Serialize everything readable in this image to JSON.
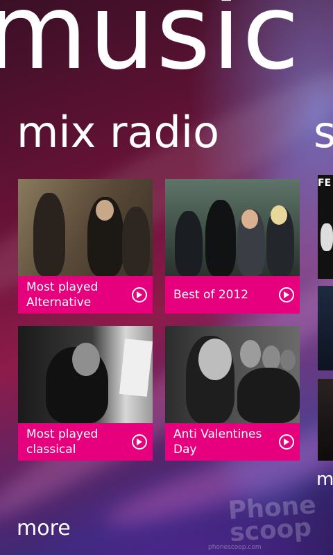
{
  "app": {
    "title": "music"
  },
  "section": {
    "title": "mix radio",
    "next_section_peek": "s"
  },
  "tiles": [
    {
      "label": "Most played Alternative",
      "play_icon": "play-circle-icon"
    },
    {
      "label": "Best of 2012",
      "play_icon": "play-circle-icon"
    },
    {
      "label": "Most played classical",
      "play_icon": "play-circle-icon"
    },
    {
      "label": "Anti Valentines Day",
      "play_icon": "play-circle-icon"
    }
  ],
  "peek": {
    "album_text": "FE",
    "more_text": "m"
  },
  "more_label": "more",
  "watermark": {
    "brand": "Phone scoop",
    "footer": "phonescoop.com"
  },
  "colors": {
    "accent": "#e6007e",
    "background": "#6a1238"
  }
}
